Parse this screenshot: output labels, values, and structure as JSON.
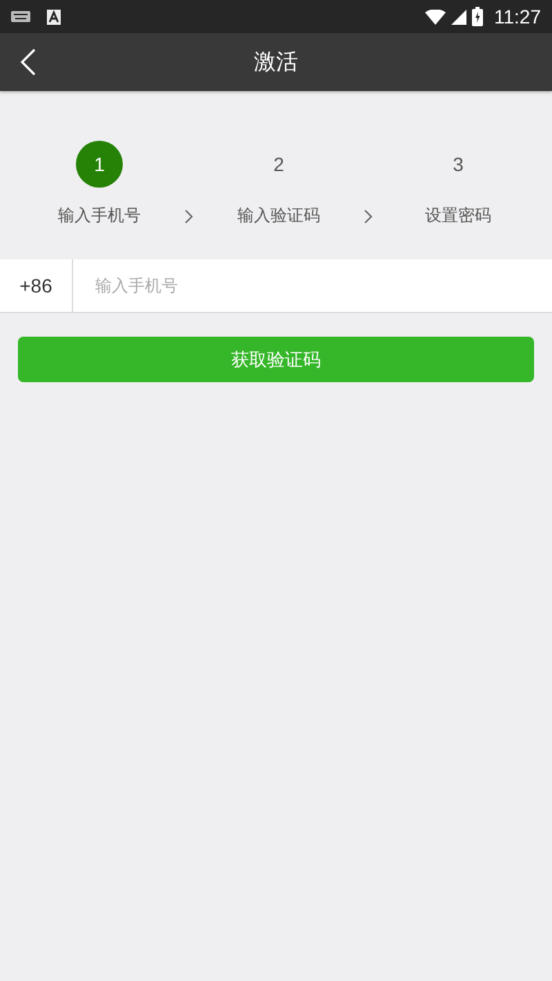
{
  "status_bar": {
    "time": "11:27"
  },
  "header": {
    "title": "激活"
  },
  "steps": [
    {
      "number": "1",
      "label": "输入手机号",
      "selected": true
    },
    {
      "number": "2",
      "label": "输入验证码",
      "selected": false
    },
    {
      "number": "3",
      "label": "设置密码",
      "selected": false
    }
  ],
  "phone": {
    "country_code": "+86",
    "placeholder": "输入手机号"
  },
  "submit_button": "获取验证码"
}
